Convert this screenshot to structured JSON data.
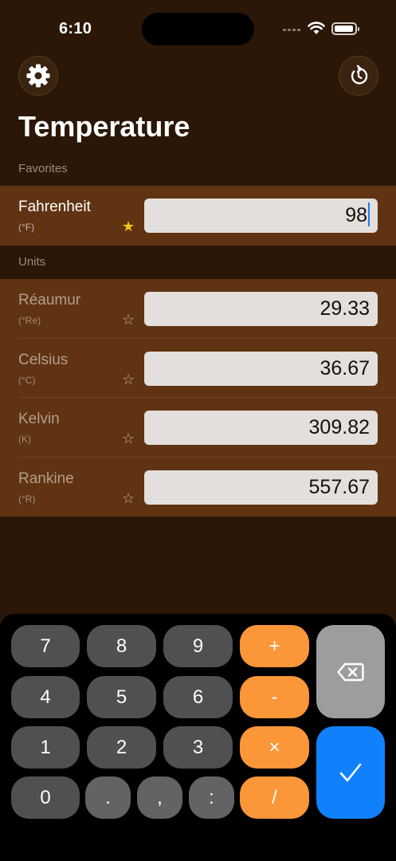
{
  "status_bar": {
    "time": "6:10"
  },
  "header": {
    "title": "Temperature"
  },
  "favorites": {
    "section_label": "Favorites",
    "items": [
      {
        "name": "Fahrenheit",
        "symbol": "(°F)",
        "value": "98",
        "favorite": true
      }
    ]
  },
  "units": {
    "section_label": "Units",
    "items": [
      {
        "name": "Réaumur",
        "symbol": "(°Re)",
        "value": "29.33",
        "favorite": false
      },
      {
        "name": "Celsius",
        "symbol": "(°C)",
        "value": "36.67",
        "favorite": false
      },
      {
        "name": "Kelvin",
        "symbol": "(K)",
        "value": "309.82",
        "favorite": false
      },
      {
        "name": "Rankine",
        "symbol": "(°R)",
        "value": "557.67",
        "favorite": false
      }
    ]
  },
  "keypad": {
    "digits": {
      "k7": "7",
      "k8": "8",
      "k9": "9",
      "k4": "4",
      "k5": "5",
      "k6": "6",
      "k1": "1",
      "k2": "2",
      "k3": "3",
      "k0": "0"
    },
    "symbols": {
      "dot": ".",
      "comma": ",",
      "colon": ":"
    },
    "operators": {
      "plus": "+",
      "minus": "-",
      "times": "×",
      "divide": "/"
    }
  },
  "icons": {
    "settings": "gear-icon",
    "reset": "reset-icon",
    "backspace": "backspace-icon",
    "done": "checkmark-icon",
    "favorite": "star-icon"
  },
  "colors": {
    "background": "#2a1707",
    "row": "#603312",
    "operator": "#fb9639",
    "done": "#1181fb",
    "star_active": "#f5c518"
  }
}
